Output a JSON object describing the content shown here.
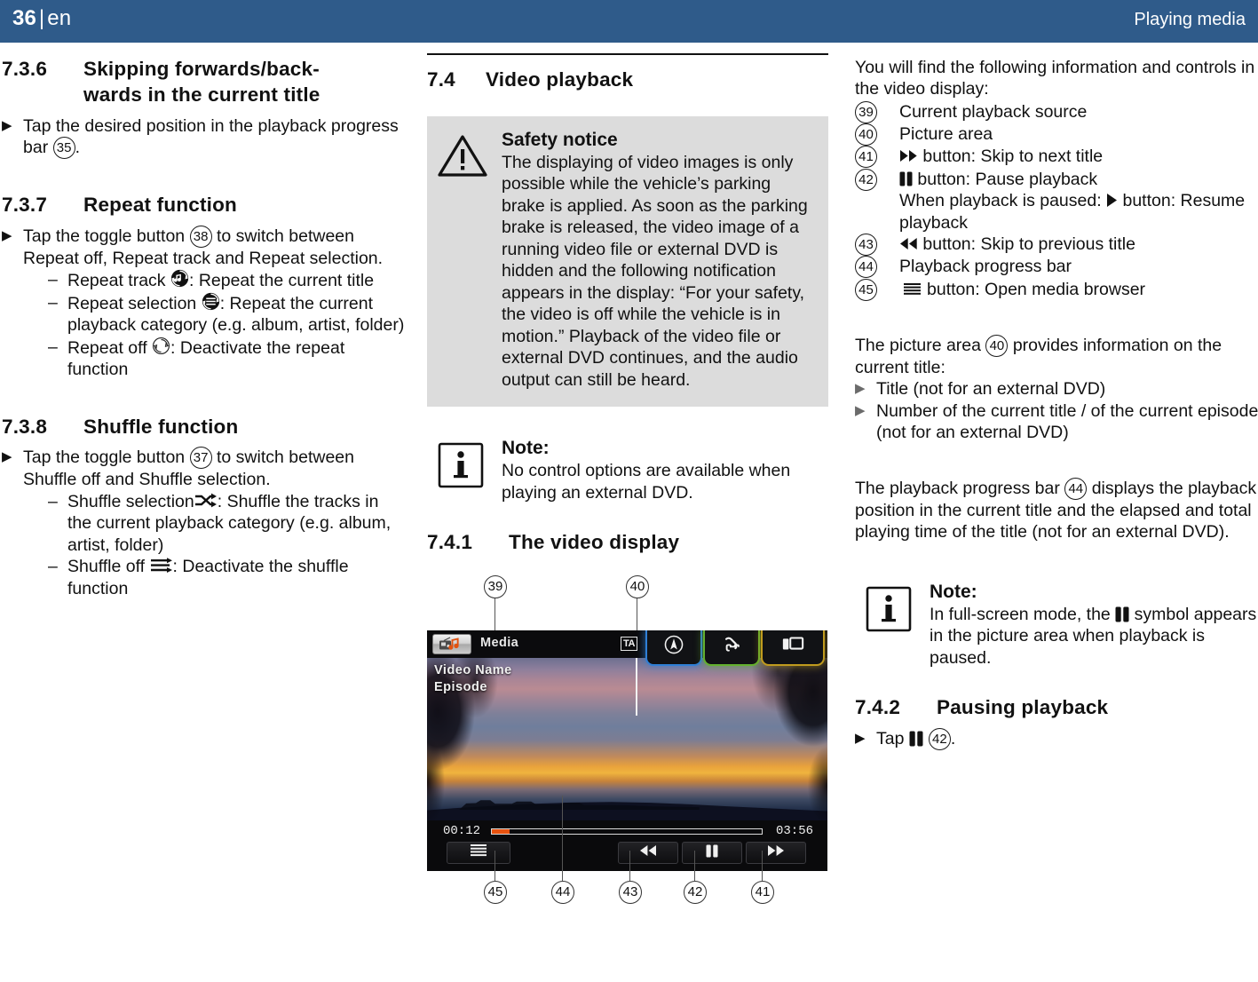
{
  "header": {
    "page_number": "36",
    "separator": "|",
    "language": "en",
    "title": "Playing media"
  },
  "left_column": {
    "s736": {
      "number": "7.3.6",
      "title": "Skipping forwards/back-wards in the current title",
      "title_line1": "Skipping forwards/back-",
      "title_line2": "wards in the current title",
      "step_text_a": "Tap the desired position in the playback progress bar ",
      "step_ref": "35",
      "step_text_b": "."
    },
    "s737": {
      "number": "7.3.7",
      "title": "Repeat function",
      "step_text_a": "Tap the toggle button ",
      "step_ref": "38",
      "step_text_b": " to switch between Repeat off, Repeat track and Repeat selection.",
      "items": [
        {
          "label_a": "Repeat track ",
          "icon": "repeat-track-icon",
          "label_b": ": Repeat the current title"
        },
        {
          "label_a": "Repeat selection ",
          "icon": "repeat-selection-icon",
          "label_b": ": Repeat the current playback category (e.g. album, artist, folder)"
        },
        {
          "label_a": "Repeat off ",
          "icon": "repeat-off-icon",
          "label_b": ": Deactivate the repeat function"
        }
      ]
    },
    "s738": {
      "number": "7.3.8",
      "title": "Shuffle function",
      "step_text_a": "Tap the toggle button ",
      "step_ref": "37",
      "step_text_b": " to switch between Shuffle off and Shuffle selection.",
      "items": [
        {
          "label_a": "Shuffle selection",
          "icon": "shuffle-on-icon",
          "label_b": ": Shuffle the tracks in the current playback category (e.g. album, artist, folder)"
        },
        {
          "label_a": "Shuffle off ",
          "icon": "shuffle-off-icon",
          "label_b": ": Deactivate the shuffle function"
        }
      ]
    }
  },
  "mid_column": {
    "s74": {
      "number": "7.4",
      "title": "Video playback"
    },
    "safety_notice": {
      "icon": "warning-triangle-icon",
      "title": "Safety notice",
      "text": "The displaying of video images is only possible while the vehicle’s parking brake is applied. As soon as the parking brake is released, the video image of a running video file or external DVD is hidden and the following notification appears in the display: “For your safety, the video is off while the vehicle is in motion.” Playback of the video file or external DVD continues, and the audio output can still be heard."
    },
    "note": {
      "icon": "info-icon",
      "title": "Note:",
      "text": "No control options are available when playing an external DVD."
    },
    "s741": {
      "number": "7.4.1",
      "title": "The video display"
    },
    "device": {
      "source_tile_icon": "media-source-icon",
      "source_label": "Media",
      "ta_badge": "TA",
      "tabs": [
        {
          "name": "navigation-tab",
          "icon": "compass-icon",
          "accent": "#2f7fd6"
        },
        {
          "name": "telephone-tab",
          "icon": "phone-icon",
          "accent": "#63b12e"
        },
        {
          "name": "media-tab",
          "icon": "media-screen-icon",
          "accent": "#c09b1e"
        }
      ],
      "title_line1": "Video Name",
      "title_line2": "Episode",
      "time_elapsed": "00:12",
      "time_total": "03:56",
      "progress_percent": 6.5,
      "progress_color": "#e8520f",
      "buttons": [
        {
          "name": "media-browser-button",
          "icon": "list-lines-icon"
        },
        {
          "name": "skip-previous-button",
          "icon": "rewind-icon"
        },
        {
          "name": "pause-button",
          "icon": "pause-icon"
        },
        {
          "name": "skip-next-button",
          "icon": "fast-forward-icon"
        }
      ],
      "callouts_top": [
        "39",
        "40"
      ],
      "callouts_bottom": [
        "45",
        "44",
        "43",
        "42",
        "41"
      ]
    }
  },
  "right_column": {
    "intro": "You will find the following information and controls in the video display:",
    "legend": [
      {
        "ref": "39",
        "text": "Current playback source"
      },
      {
        "ref": "40",
        "text": "Picture area"
      },
      {
        "ref": "41",
        "icon": "fast-forward-icon",
        "text": "button: Skip to next title"
      },
      {
        "ref": "42",
        "icon": "pause-icon",
        "text": "button: Pause playback",
        "text2_a": "When playback is paused: ",
        "text2_icon": "play-icon",
        "text2_b": " button: Resume playback"
      },
      {
        "ref": "43",
        "icon": "rewind-icon",
        "text": "button: Skip to previous title"
      },
      {
        "ref": "44",
        "text": "Playback progress bar"
      },
      {
        "ref": "45",
        "icon": "list-lines-icon",
        "text": "button: Open media browser"
      }
    ],
    "picture_area_para_a": "The picture area ",
    "picture_area_ref": "40",
    "picture_area_para_b": " provides information on the current title:",
    "picture_area_items": [
      "Title (not for an external DVD)",
      "Number of the current title / of the current episode (not for an external DVD)"
    ],
    "progress_para_a": "The playback progress bar ",
    "progress_ref": "44",
    "progress_para_b": " displays the playback position in the current title and the elapsed and total playing time of the title (not for an external DVD).",
    "note": {
      "icon": "info-icon",
      "title": "Note:",
      "text_a": "In full-screen mode, the ",
      "text_icon": "pause-icon",
      "text_b": " symbol appears in the picture area when playback is paused."
    },
    "s742": {
      "number": "7.4.2",
      "title": "Pausing playback",
      "step_a": "Tap ",
      "step_icon": "pause-icon",
      "step_ref": "42",
      "step_b": "."
    }
  },
  "colors": {
    "header_blue": "#2f5b8a",
    "notice_gray": "#dcdcdc",
    "accent_orange": "#e8520f"
  }
}
